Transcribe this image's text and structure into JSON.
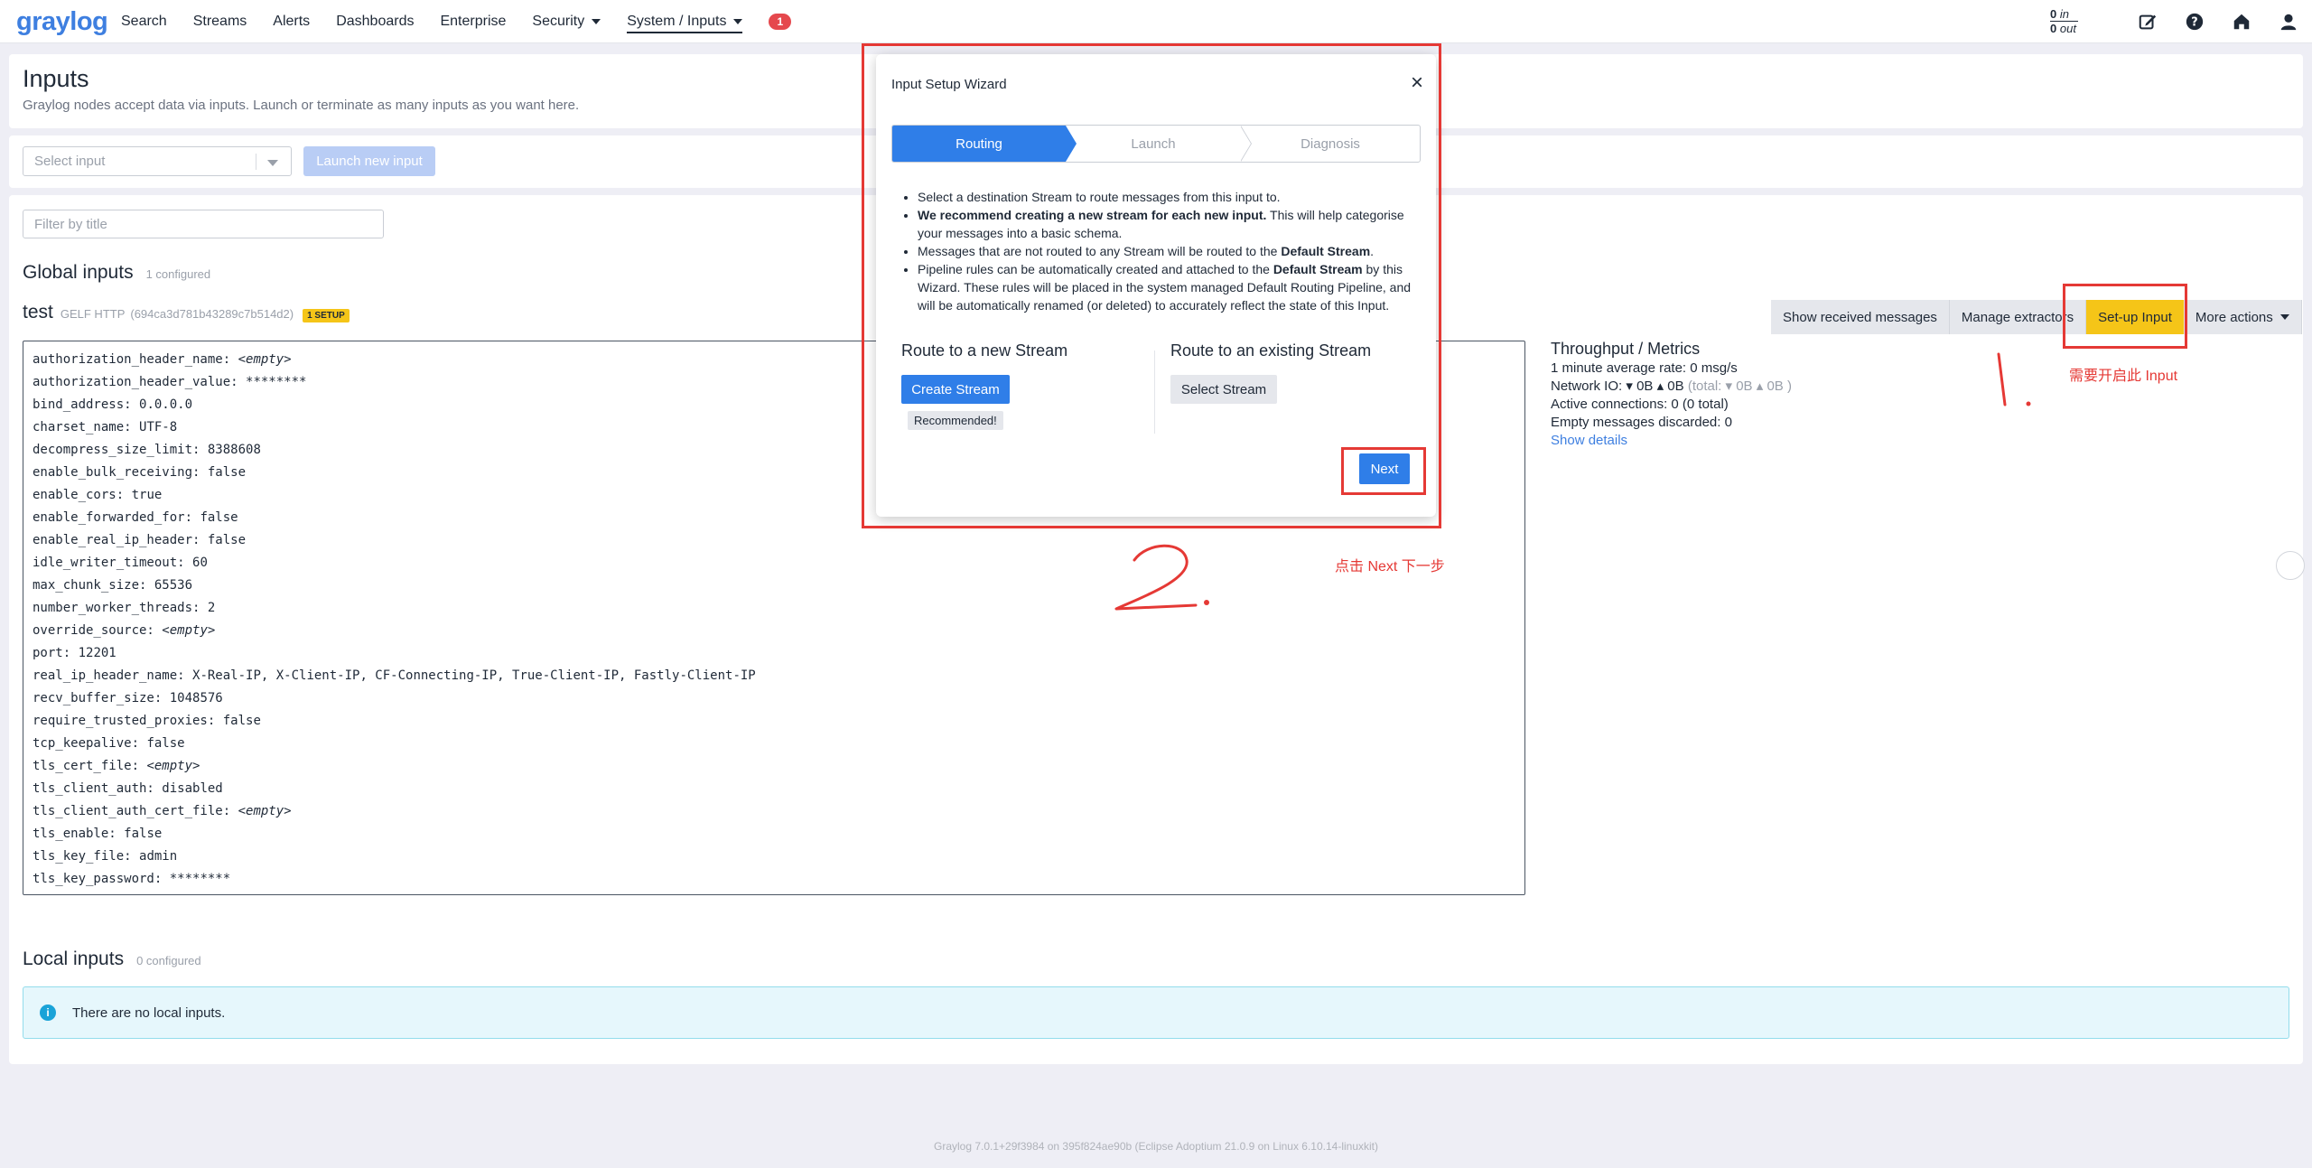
{
  "navbar": {
    "logo": "graylog",
    "items": [
      {
        "label": "Search"
      },
      {
        "label": "Streams"
      },
      {
        "label": "Alerts"
      },
      {
        "label": "Dashboards"
      },
      {
        "label": "Enterprise"
      },
      {
        "label": "Security"
      },
      {
        "label": "System / Inputs"
      }
    ],
    "notification_count": "1",
    "throughput": {
      "in_value": "0",
      "in_label": "in",
      "out_value": "0",
      "out_label": "out"
    },
    "icons": [
      "edit-icon",
      "help-icon",
      "home-icon",
      "user-icon"
    ]
  },
  "header": {
    "title": "Inputs",
    "description": "Graylog nodes accept data via inputs. Launch or terminate as many inputs as you want here."
  },
  "controls": {
    "select_placeholder": "Select input",
    "launch_label": "Launch new input"
  },
  "main": {
    "filter_placeholder": "Filter by title",
    "global_title": "Global inputs",
    "global_count": "1 configured",
    "input": {
      "name": "test",
      "type": "GELF HTTP",
      "id": "(694ca3d781b43289c7b514d2)",
      "badge": "1 SETUP"
    },
    "config": [
      {
        "key": "authorization_header_name:",
        "value": "<empty>",
        "empty": true
      },
      {
        "key": "authorization_header_value:",
        "value": "********"
      },
      {
        "key": "bind_address:",
        "value": "0.0.0.0"
      },
      {
        "key": "charset_name:",
        "value": "UTF-8"
      },
      {
        "key": "decompress_size_limit:",
        "value": "8388608"
      },
      {
        "key": "enable_bulk_receiving:",
        "value": "false"
      },
      {
        "key": "enable_cors:",
        "value": "true"
      },
      {
        "key": "enable_forwarded_for:",
        "value": "false"
      },
      {
        "key": "enable_real_ip_header:",
        "value": "false"
      },
      {
        "key": "idle_writer_timeout:",
        "value": "60"
      },
      {
        "key": "max_chunk_size:",
        "value": "65536"
      },
      {
        "key": "number_worker_threads:",
        "value": "2"
      },
      {
        "key": "override_source:",
        "value": "<empty>",
        "empty": true
      },
      {
        "key": "port:",
        "value": "12201"
      },
      {
        "key": "real_ip_header_name:",
        "value": "X-Real-IP, X-Client-IP, CF-Connecting-IP, True-Client-IP, Fastly-Client-IP"
      },
      {
        "key": "recv_buffer_size:",
        "value": "1048576"
      },
      {
        "key": "require_trusted_proxies:",
        "value": "false"
      },
      {
        "key": "tcp_keepalive:",
        "value": "false"
      },
      {
        "key": "tls_cert_file:",
        "value": "<empty>",
        "empty": true
      },
      {
        "key": "tls_client_auth:",
        "value": "disabled"
      },
      {
        "key": "tls_client_auth_cert_file:",
        "value": "<empty>",
        "empty": true
      },
      {
        "key": "tls_enable:",
        "value": "false"
      },
      {
        "key": "tls_key_file:",
        "value": "admin"
      },
      {
        "key": "tls_key_password:",
        "value": "********"
      }
    ],
    "actions": {
      "show_messages": "Show received messages",
      "manage_extractors": "Manage extractors",
      "setup_input": "Set-up Input",
      "more_actions": "More actions"
    },
    "metrics": {
      "title": "Throughput / Metrics",
      "avg_rate": "1 minute average rate: 0 msg/s",
      "network_label": "Network IO:",
      "net_down": "0B",
      "net_up": "0B",
      "total_label": "(total:",
      "total_down": "0B",
      "total_up": "0B )",
      "active_connections": "Active connections: 0 (0 total)",
      "empty_discarded": "Empty messages discarded: 0",
      "show_details": "Show details"
    },
    "local_title": "Local inputs",
    "local_count": "0 configured",
    "no_local": "There are no local inputs."
  },
  "footer": "Graylog 7.0.1+29f3984 on 395f824ae90b (Eclipse Adoptium 21.0.9 on Linux 6.10.14-linuxkit)",
  "modal": {
    "title": "Input Setup Wizard",
    "close": "×",
    "steps": [
      "Routing",
      "Launch",
      "Diagnosis"
    ],
    "bullets": {
      "b1": "Select a destination Stream to route messages from this input to.",
      "b2_bold": "We recommend creating a new stream for each new input.",
      "b2_rest": " This will help categorise your messages into a basic schema.",
      "b3_pre": "Messages that are not routed to any Stream will be routed to the ",
      "b3_bold": "Default Stream",
      "b3_post": ".",
      "b4_pre": "Pipeline rules can be automatically created and attached to the ",
      "b4_bold": "Default Stream",
      "b4_post": " by this Wizard. These rules will be placed in the system managed Default Routing Pipeline, and will be automatically renamed (or deleted) to accurately reflect the state of this Input."
    },
    "route_new_title": "Route to a new Stream",
    "create_stream": "Create Stream",
    "recommended": "Recommended!",
    "route_existing_title": "Route to an existing Stream",
    "select_stream": "Select Stream",
    "next": "Next"
  },
  "annotations": {
    "note_1": "需要开启此 Input",
    "note_2": "点击 Next 下一步",
    "color": "#e53935"
  }
}
